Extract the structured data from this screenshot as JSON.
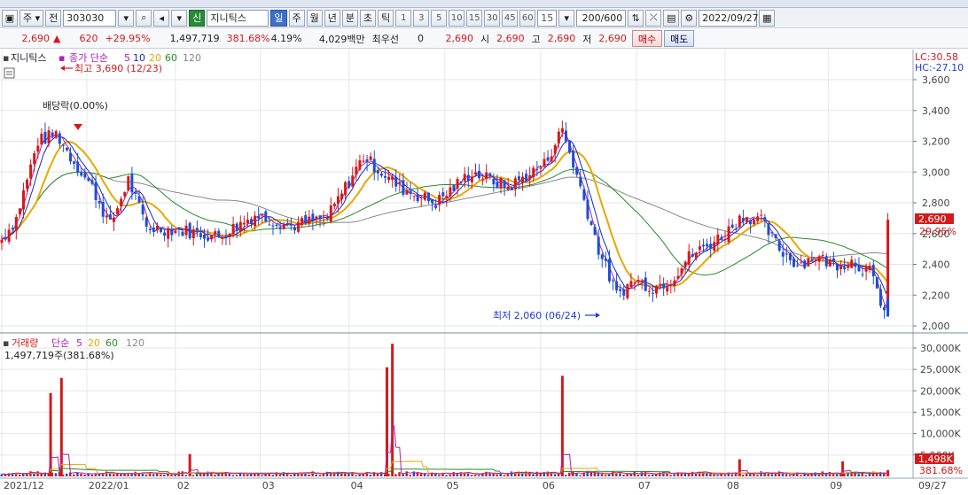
{
  "toolbar": {
    "market_label": "주",
    "type_label": "전",
    "code": "303030",
    "badge": "신",
    "name": "지니틱스",
    "periods": [
      "일",
      "주",
      "월",
      "년",
      "분",
      "초",
      "틱"
    ],
    "intervals": [
      "1",
      "3",
      "5",
      "10",
      "15",
      "30",
      "45",
      "60"
    ],
    "interval_value": "15",
    "count": "200/600",
    "date": "2022/09/27"
  },
  "quote": {
    "price": "2,690",
    "change": "620",
    "change_pct": "+29.95%",
    "volume": "1,497,719",
    "volume_ratio": "381.68%",
    "turnover_pct": "4.19%",
    "amount": "4,029백만",
    "priority_label": "최우선",
    "priority_value": "0",
    "priority_price": "2,690",
    "open_label": "시",
    "open": "2,690",
    "high_label": "고",
    "high": "2,690",
    "low_label": "저",
    "low": "2,690",
    "buy_label": "매수",
    "sell_label": "매도"
  },
  "price_panel": {
    "name": "지니틱스",
    "indicator_label": "종가 단순",
    "ma_periods": [
      "5",
      "10",
      "20",
      "60",
      "120"
    ],
    "lc": "LC:30.58",
    "hc": "HC:-27.10",
    "high_note": "최고 3,690 (12/23)",
    "low_note": "최저 2,060 (06/24)",
    "dividend_note": "배당락(0.00%)",
    "last_price": "2,690",
    "last_pct": "29.95%",
    "y_ticks": [
      "3,600",
      "3,400",
      "3,200",
      "3,000",
      "2,800",
      "2,600",
      "2,400",
      "2,200",
      "2,000"
    ]
  },
  "volume_panel": {
    "label": "거래량",
    "indicator_label": "단순",
    "ma_periods": [
      "5",
      "20",
      "60",
      "120"
    ],
    "value_line": "1,497,719주(381.68%)",
    "y_ticks": [
      "30,000K",
      "25,000K",
      "20,000K",
      "15,000K",
      "10,000K",
      "5,000K"
    ],
    "last_value": "1,498K",
    "last_pct": "381.68%"
  },
  "x_axis": {
    "labels": [
      "2021/12",
      "2022/01",
      "02",
      "03",
      "04",
      "05",
      "06",
      "07",
      "08",
      "09"
    ],
    "end_label": "09/27"
  },
  "colors": {
    "up": "#d41a1a",
    "down": "#1c4fd4",
    "ma5": "#b020b0",
    "ma10": "#1a2bb0",
    "ma20": "#e8a800",
    "ma60": "#2a8a2a",
    "ma120": "#888888"
  },
  "chart_data": {
    "type": "candlestick",
    "title": "지니틱스",
    "ylim": [
      1950,
      3700
    ],
    "anchors": [
      [
        0,
        2560
      ],
      [
        8,
        2700
      ],
      [
        20,
        3200
      ],
      [
        30,
        3250
      ],
      [
        38,
        3100
      ],
      [
        50,
        2900
      ],
      [
        60,
        2650
      ],
      [
        70,
        2950
      ],
      [
        80,
        2640
      ],
      [
        100,
        2620
      ],
      [
        120,
        2580
      ],
      [
        140,
        2720
      ],
      [
        160,
        2650
      ],
      [
        180,
        2700
      ],
      [
        200,
        3100
      ],
      [
        220,
        2900
      ],
      [
        240,
        2800
      ],
      [
        260,
        3000
      ],
      [
        280,
        2900
      ],
      [
        300,
        3050
      ],
      [
        310,
        3280
      ],
      [
        320,
        2900
      ],
      [
        330,
        2500
      ],
      [
        340,
        2200
      ],
      [
        350,
        2300
      ],
      [
        360,
        2250
      ],
      [
        370,
        2300
      ],
      [
        380,
        2450
      ],
      [
        390,
        2520
      ],
      [
        400,
        2600
      ],
      [
        410,
        2720
      ],
      [
        420,
        2680
      ],
      [
        430,
        2500
      ],
      [
        440,
        2400
      ],
      [
        450,
        2450
      ],
      [
        460,
        2400
      ],
      [
        470,
        2420
      ],
      [
        480,
        2350
      ],
      [
        489,
        2070
      ],
      [
        490,
        2690
      ]
    ],
    "volume_ylim": [
      0,
      32000
    ],
    "volume_spikes": [
      [
        27,
        19500
      ],
      [
        33,
        23000
      ],
      [
        104,
        5200
      ],
      [
        213,
        25500
      ],
      [
        216,
        31000
      ],
      [
        310,
        23500
      ],
      [
        408,
        4000
      ],
      [
        465,
        3500
      ],
      [
        490,
        1498
      ]
    ]
  }
}
